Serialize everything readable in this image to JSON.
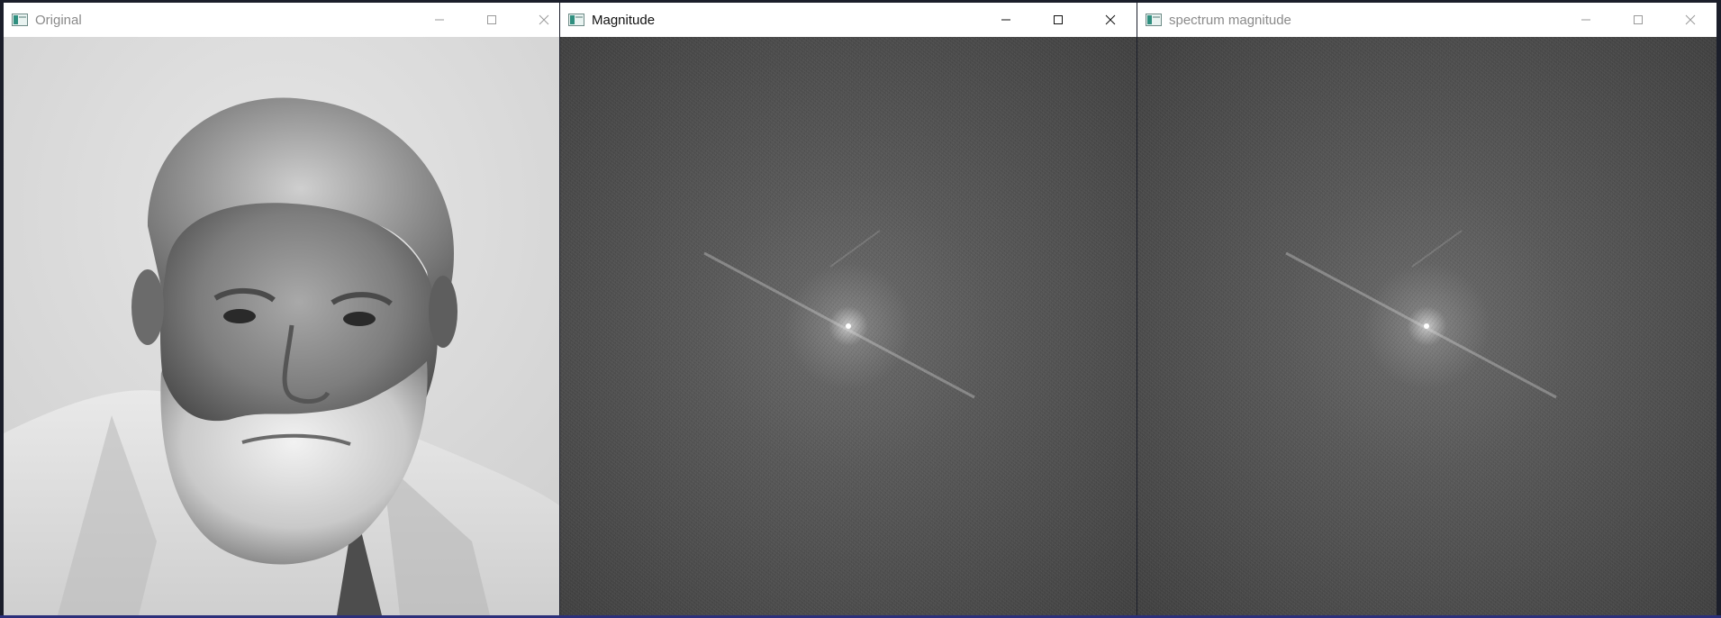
{
  "windows": [
    {
      "title": "Original",
      "active": false,
      "content": "photo",
      "icon": "app-image-icon",
      "controls": [
        "minimize-icon",
        "maximize-icon",
        "close-icon"
      ]
    },
    {
      "title": "Magnitude",
      "active": true,
      "content": "spectrum",
      "icon": "app-image-icon",
      "controls": [
        "minimize-icon",
        "maximize-icon",
        "close-icon"
      ]
    },
    {
      "title": "spectrum magnitude",
      "active": false,
      "content": "spectrum",
      "icon": "app-image-icon",
      "controls": [
        "minimize-icon",
        "maximize-icon",
        "close-icon"
      ]
    }
  ],
  "colors": {
    "title_active": "#111111",
    "title_inactive": "#8a8a8a",
    "spectrum_bg": "#555555",
    "taskbar_line": "#2b2f7a"
  }
}
